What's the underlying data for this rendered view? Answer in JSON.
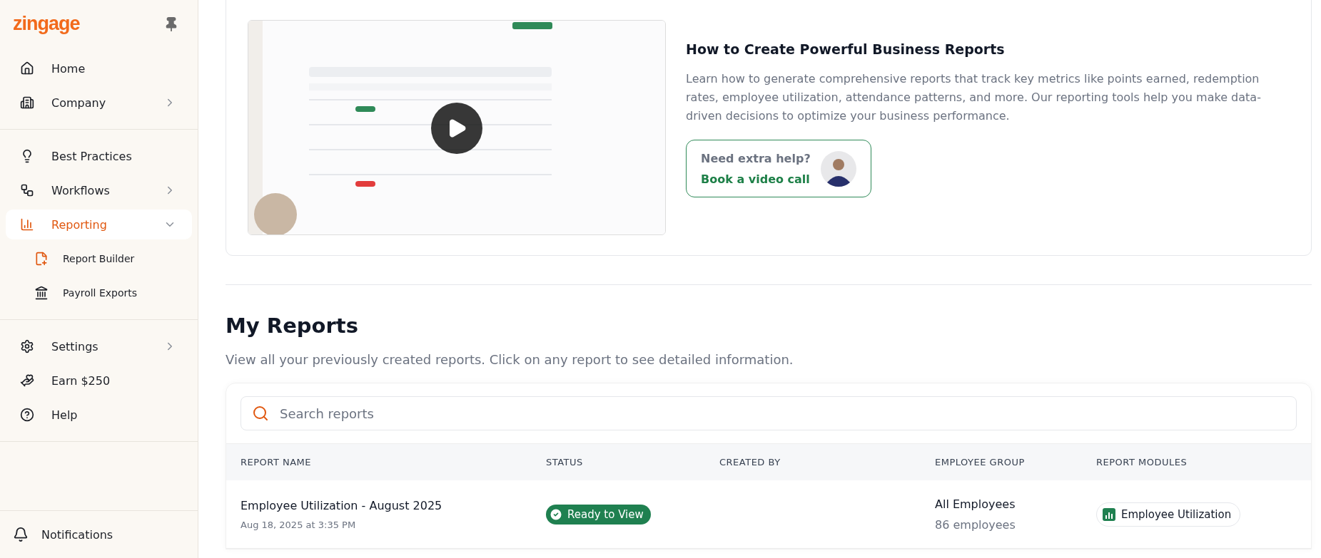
{
  "sidebar": {
    "logo": "zingage",
    "sections": [
      [
        {
          "label": "Home",
          "kind": "link",
          "selected": false
        },
        {
          "label": "Company",
          "kind": "group",
          "expanded": false,
          "selected": false
        }
      ],
      [
        {
          "label": "Best Practices",
          "kind": "link",
          "selected": false
        },
        {
          "label": "Workflows",
          "kind": "group",
          "expanded": false,
          "selected": false
        },
        {
          "label": "Reporting",
          "kind": "group",
          "expanded": true,
          "selected": true,
          "children": [
            {
              "label": "Report Builder"
            },
            {
              "label": "Payroll Exports"
            }
          ]
        }
      ],
      [
        {
          "label": "Settings",
          "kind": "group",
          "expanded": false,
          "selected": false
        },
        {
          "label": "Earn $250",
          "kind": "link",
          "selected": false
        },
        {
          "label": "Help",
          "kind": "link",
          "selected": false
        }
      ]
    ],
    "notifications": "Notifications"
  },
  "tutorial": {
    "title": "How to Create Powerful Business Reports",
    "description": "Learn how to generate comprehensive reports that track key metrics like points earned, redemption rates, employee utilization, attendance patterns, and more. Our reporting tools help you make data-driven decisions to optimize your business performance.",
    "help": {
      "question": "Need extra help?",
      "link": "Book a video call"
    }
  },
  "reports": {
    "title": "My Reports",
    "description": "View all your previously created reports. Click on any report to see detailed information.",
    "search": {
      "placeholder": "Search reports"
    },
    "columns": [
      "REPORT NAME",
      "STATUS",
      "CREATED BY",
      "EMPLOYEE GROUP",
      "REPORT MODULES"
    ],
    "rows": [
      {
        "name": "Employee Utilization - August 2025",
        "date": "Aug 18, 2025 at 3:35 PM",
        "status": {
          "label": "Ready to View",
          "kind": "ready"
        },
        "group": "All Employees",
        "group_count": "86 employees",
        "modules": [
          "Employee Utilization"
        ]
      }
    ]
  }
}
